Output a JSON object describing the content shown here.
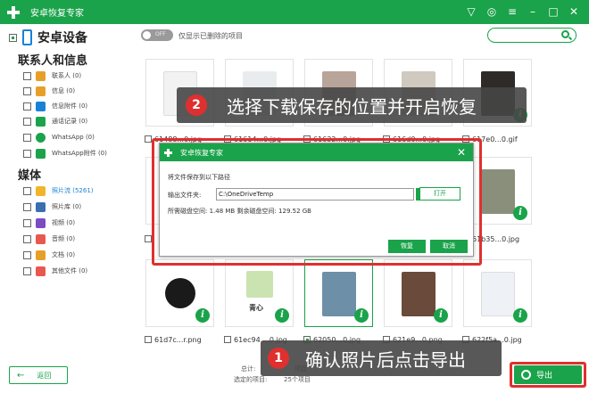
{
  "window": {
    "title": "安卓恢复专家"
  },
  "sidebar": {
    "device_label": "安卓设备",
    "group_contacts": "联系人和信息",
    "contact_items": [
      {
        "label": "联系人 (0)",
        "icon": "contacts-icon",
        "color": "#e6a02a"
      },
      {
        "label": "信息 (0)",
        "icon": "message-icon",
        "color": "#e6a02a"
      },
      {
        "label": "信息附件 (0)",
        "icon": "attachment-icon",
        "color": "#1a82d6"
      },
      {
        "label": "通话记录 (0)",
        "icon": "call-log-icon",
        "color": "#1aa34a"
      },
      {
        "label": "WhatsApp (0)",
        "icon": "whatsapp-icon",
        "color": "#1aa34a"
      },
      {
        "label": "WhatsApp附件 (0)",
        "icon": "whatsapp-attachment-icon",
        "color": "#1aa34a"
      }
    ],
    "group_media": "媒体",
    "media_items": [
      {
        "label": "照片流 (5261)",
        "icon": "photo-stream-icon",
        "color": "#f1b52a",
        "active": true
      },
      {
        "label": "照片库 (0)",
        "icon": "photo-library-icon",
        "color": "#3a6fb0"
      },
      {
        "label": "视频 (0)",
        "icon": "video-icon",
        "color": "#7b4cc4"
      },
      {
        "label": "音频 (0)",
        "icon": "audio-icon",
        "color": "#e8584f"
      },
      {
        "label": "文档 (0)",
        "icon": "document-icon",
        "color": "#e6a02a"
      },
      {
        "label": "其他文件 (0)",
        "icon": "other-files-icon",
        "color": "#e8584f"
      }
    ],
    "back_label": "返回"
  },
  "toolbar": {
    "toggle_state": "OFF",
    "toggle_label": "仅显示已删除的项目"
  },
  "grid": {
    "row1": [
      "61488...0.jpg",
      "61614...0.jpg",
      "61632...0.jpg",
      "616d0...0.jpg",
      "617e0...0.gif"
    ],
    "row2": [
      "61b35...0.jpg"
    ],
    "row3": [
      "61d7c...r.png",
      "61ec94....0.jpg",
      "62050...0.jpg",
      "621e9...0.png",
      "622f5a...0.jpg"
    ],
    "tile_text": "青心"
  },
  "dialog": {
    "title": "安卓恢复专家",
    "save_to": "将文件保存到以下路径",
    "output_label": "输出文件夹:",
    "output_path": "C:\\OneDriveTemp",
    "browse": "...",
    "open_btn": "打开",
    "space_info": "所需磁盘空间:  1.48 MB  剩余磁盘空间:  129.52 GB",
    "ok_btn": "恢复",
    "cancel_btn": "取消"
  },
  "annotations": {
    "step2_num": "2",
    "step2_text": "选择下载保存的位置并开启恢复",
    "step1_num": "1",
    "step1_text": "确认照片后点击导出"
  },
  "footer": {
    "total_label": "总计:",
    "total_value": "项目",
    "selected_label": "选定的项目:",
    "selected_value": "25个项目",
    "export_btn": "导出"
  }
}
